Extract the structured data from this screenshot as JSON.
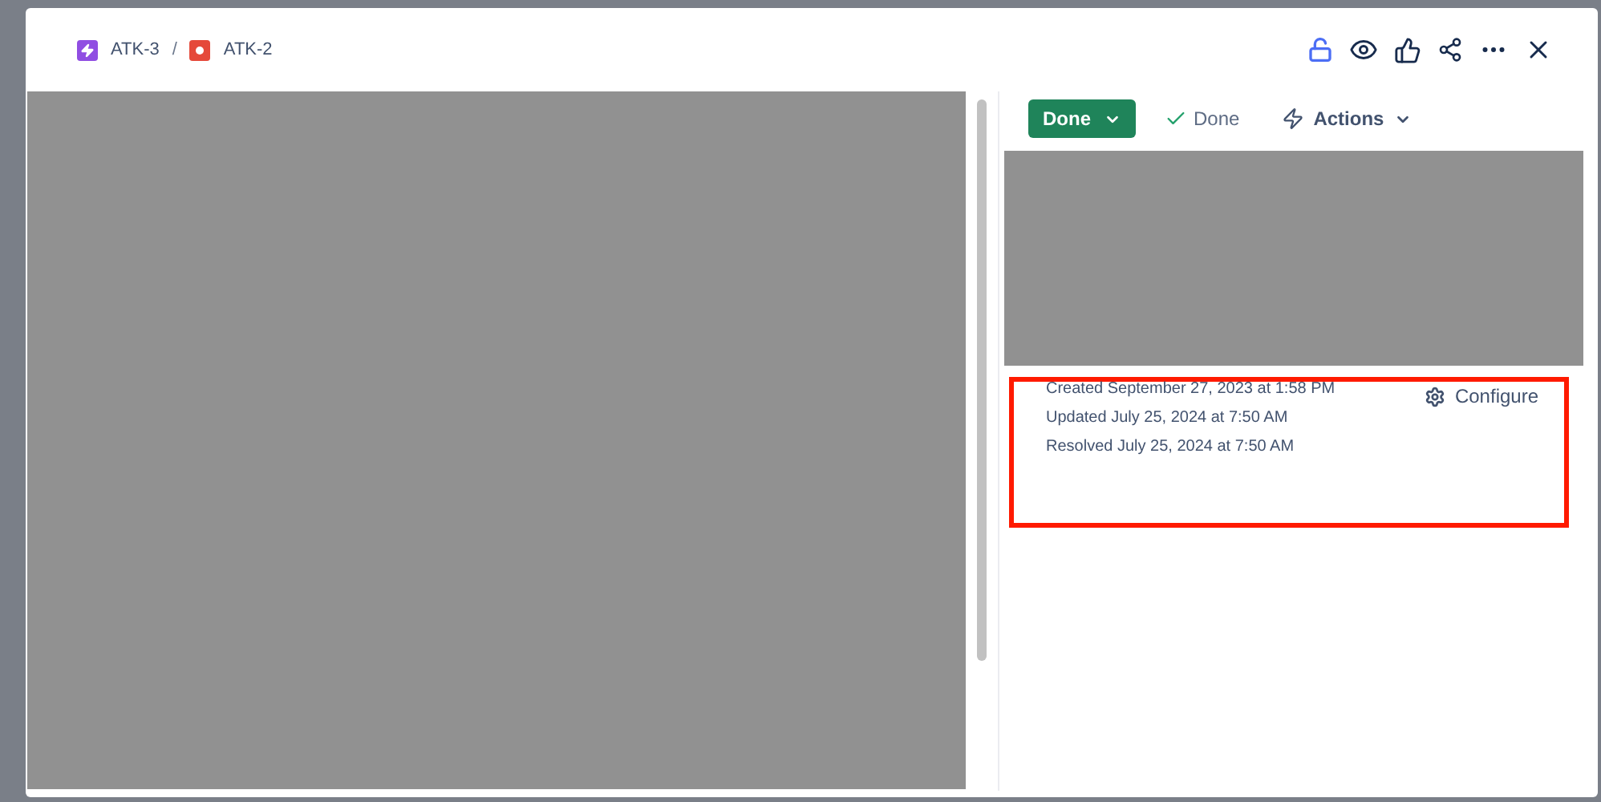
{
  "breadcrumbs": [
    {
      "label": "ATK-3",
      "kind": "epic"
    },
    {
      "label": "ATK-2",
      "kind": "bug"
    }
  ],
  "breadcrumb_separator": "/",
  "status_button": {
    "label": "Done"
  },
  "resolution": {
    "label": "Done"
  },
  "actions_button": {
    "label": "Actions"
  },
  "dates": [
    "Created September 27, 2023 at 1:58 PM",
    "Updated July 25, 2024 at 7:50 AM",
    "Resolved July 25, 2024 at 7:50 AM"
  ],
  "configure_button": {
    "label": "Configure"
  }
}
